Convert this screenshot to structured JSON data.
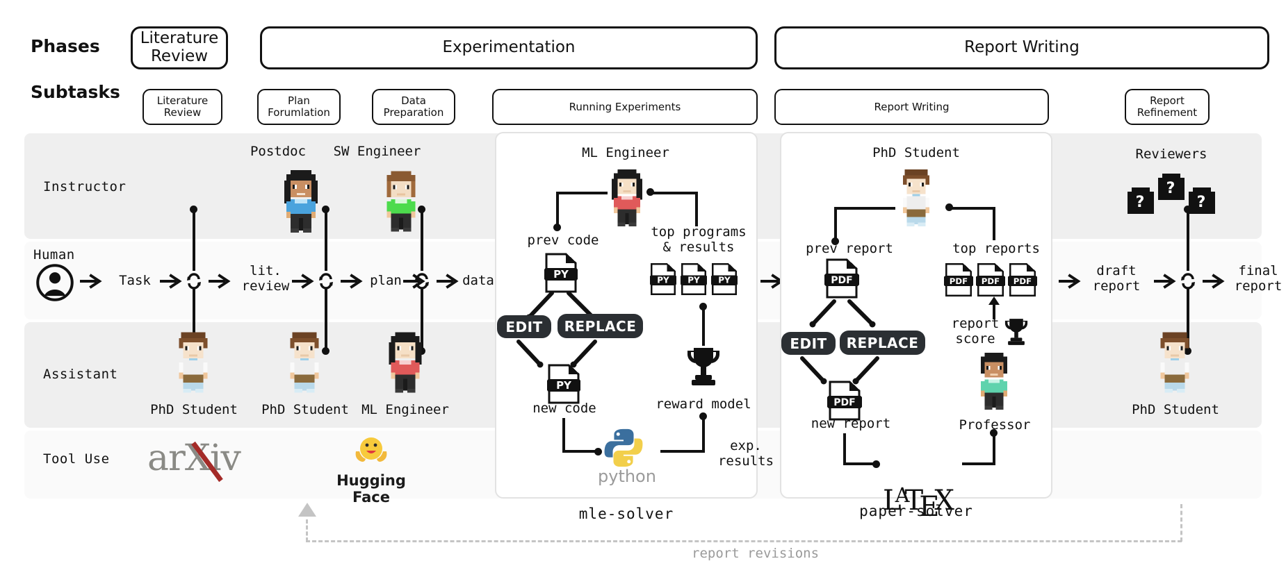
{
  "figure": {
    "left_labels": {
      "phases": "Phases",
      "subtasks": "Subtasks",
      "instructor": "Instructor",
      "human": "Human",
      "assistant": "Assistant",
      "tool_use": "Tool Use"
    },
    "phases": [
      {
        "label": "Literature\nReview"
      },
      {
        "label": "Experimentation"
      },
      {
        "label": "Report Writing"
      }
    ],
    "subtasks": [
      {
        "label": "Literature\nReview"
      },
      {
        "label": "Plan\nForumlation"
      },
      {
        "label": "Data\nPreparation"
      },
      {
        "label": "Running Experiments"
      },
      {
        "label": "Report Writing"
      },
      {
        "label": "Report\nRefinement"
      }
    ],
    "instructor_agents": [
      {
        "name": "Postdoc"
      },
      {
        "name": "SW Engineer"
      },
      {
        "name": "Reviewers"
      }
    ],
    "assistant_agents": [
      {
        "name": "PhD Student"
      },
      {
        "name": "PhD Student"
      },
      {
        "name": "ML Engineer"
      },
      {
        "name": "PhD Student"
      }
    ],
    "flow": [
      {
        "label": "Task"
      },
      {
        "label": "lit.\nreview"
      },
      {
        "label": "plan"
      },
      {
        "label": "data"
      },
      {
        "label": "draft\nreport"
      },
      {
        "label": "final\nreport"
      }
    ],
    "tools": [
      {
        "name": "arXiv",
        "label": "arXiv"
      },
      {
        "name": "Hugging Face",
        "label": "Hugging Face"
      }
    ],
    "mle_solver": {
      "title": "mle-solver",
      "agent": "ML Engineer",
      "nodes": {
        "prev_code": "prev code",
        "new_code": "new code",
        "top_programs": "top programs\n& results",
        "reward_model": "reward model",
        "exp_results": "exp.\nresults"
      },
      "actions": [
        {
          "label": "EDIT"
        },
        {
          "label": "REPLACE"
        }
      ],
      "file_badges": {
        "code": "PY"
      },
      "top_programs_count": 3,
      "tool": "python"
    },
    "paper_solver": {
      "title": "paper-solver",
      "agent": "PhD Student",
      "reviewer_agent": "Professor",
      "nodes": {
        "prev_report": "prev report",
        "new_report": "new report",
        "top_reports": "top reports",
        "report_score": "report\nscore"
      },
      "actions": [
        {
          "label": "EDIT"
        },
        {
          "label": "REPLACE"
        }
      ],
      "file_badges": {
        "report": "PDF"
      },
      "top_reports_count": 3,
      "tool": "LaTeX"
    },
    "feedback_loop": {
      "label": "report revisions"
    },
    "colors": {
      "band_grey": "#efefef",
      "band_light": "#fafafa",
      "ink": "#111111",
      "pill": "#2b2f33",
      "dashed": "#c4c4c4",
      "arxiv": "#8a8a85",
      "arxiv_x": "#a42b28",
      "hf_yellow": "#f7ca3c",
      "python_blue": "#3b6f9e",
      "python_yellow": "#f2cf4b",
      "shirt_postdoc": "#4aa3dd",
      "shirt_swe": "#4ddb4d",
      "shirt_mle": "#e05a5a",
      "shirt_phd": "#e8e8e8",
      "shirt_prof": "#5fd3ad"
    }
  }
}
